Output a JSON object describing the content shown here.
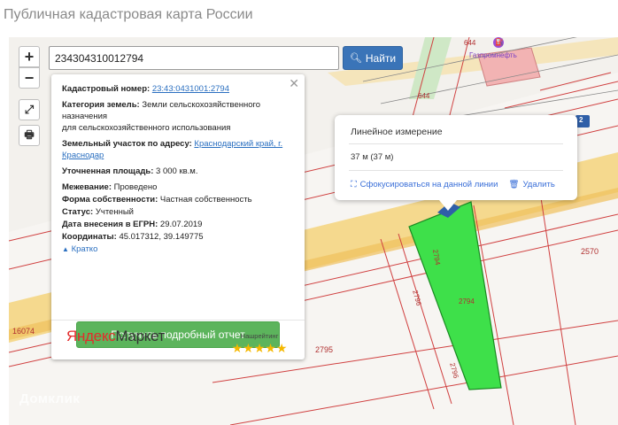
{
  "page_title": "Публичная кадастровая карта России",
  "search": {
    "value": "234304310012794",
    "button_label": "Найти"
  },
  "map": {
    "labels": [
      "644",
      "644",
      "2570",
      "16074",
      "2795",
      "2794",
      "2796",
      "2796",
      "2794"
    ],
    "poi_label": "Газпромнефть",
    "watermark": "Домклик",
    "road_badge": "2"
  },
  "info": {
    "cadastral_label": "Кадастровый номер:",
    "cadastral_value": "23:43:0431001:2794",
    "category_label": "Категория земель:",
    "category_value_1": "Земли сельскохозяйственного назначения",
    "category_value_2": "для сельскохозяйственного использования",
    "address_label": "Земельный участок по адресу:",
    "address_value": "Краснодарский край, г. Краснодар",
    "area_label": "Уточненная площадь:",
    "area_value": "3 000 кв.м.",
    "survey_label": "Межевание:",
    "survey_value": "Проведено",
    "ownership_label": "Форма собственности:",
    "ownership_value": "Частная собственность",
    "status_label": "Статус:",
    "status_value": "Учтенный",
    "date_label": "Дата внесения в ЕГРН:",
    "date_value": "29.07.2019",
    "coords_label": "Координаты:",
    "coords_value": "45.017312, 39.149775",
    "collapse_link": "Кратко",
    "report_button": "Получить подробный отчет",
    "ym_logo_1": "Яндекс",
    "ym_logo_2": "Маркет",
    "rating_label": "Нашрейтинг",
    "stars": "★★★★★"
  },
  "measure": {
    "title": "Линейное измерение",
    "value": "37 м (37 м)",
    "focus_action": "Сфокусироваться на данной линии",
    "delete_action": "Удалить"
  },
  "colors": {
    "parcel_fill": "#3ee04a",
    "parcel_line": "#1a8a22",
    "road": "#f5d37c",
    "cadastral_line": "#d04040",
    "search_button": "#3a74b8",
    "report_button": "#5cb45c",
    "link": "#2a6fc0"
  },
  "icons": [
    "plus-icon",
    "minus-icon",
    "expand-icon",
    "printer-icon",
    "search-icon",
    "close-icon",
    "chevron-up-icon",
    "focus-icon",
    "trash-icon",
    "gas-station-icon"
  ]
}
